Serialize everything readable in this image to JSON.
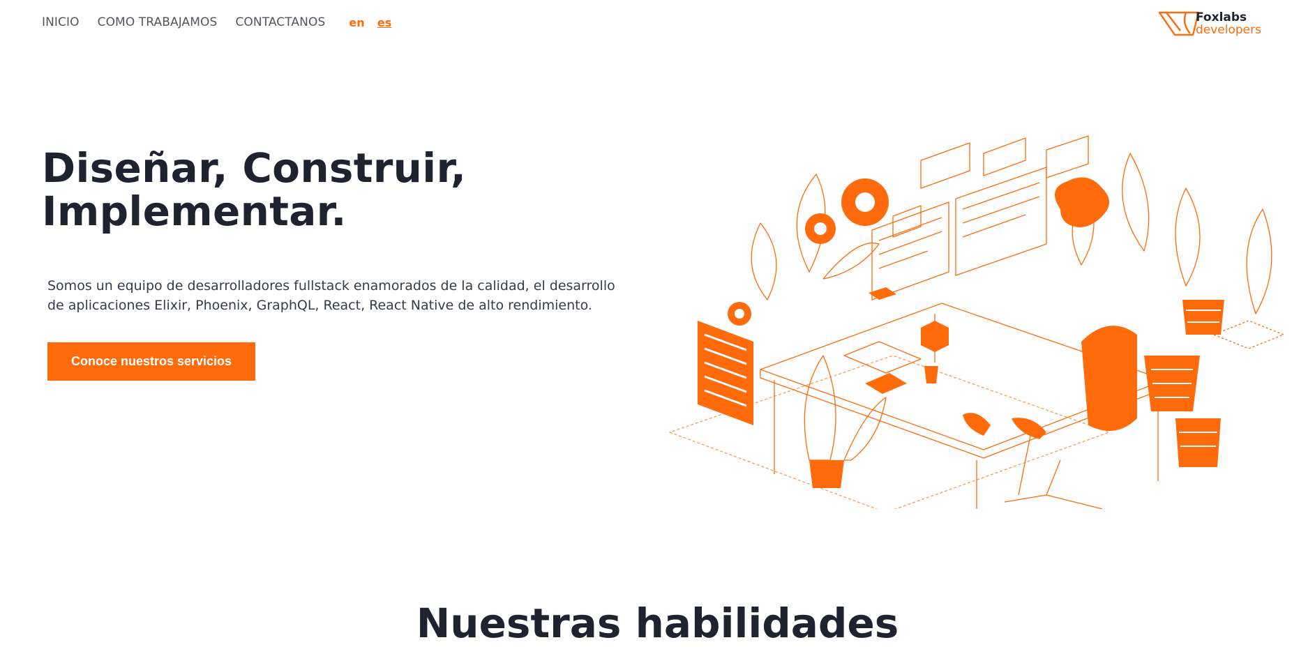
{
  "nav": {
    "items": [
      {
        "label": "INICIO"
      },
      {
        "label": "COMO TRABAJAMOS"
      },
      {
        "label": "CONTACTANOS"
      }
    ],
    "languages": [
      {
        "label": "en",
        "active": false
      },
      {
        "label": "es",
        "active": true
      }
    ]
  },
  "logo": {
    "line1": "Foxlabs",
    "line2": "developers",
    "icon": "foxlabs-logo-icon"
  },
  "hero": {
    "title_line1": "Diseñar, Construir,",
    "title_line2": "Implementar.",
    "description": "Somos un equipo de desarrolladores fullstack enamorados de la calidad, el desarrollo de aplicaciones Elixir, Phoenix, GraphQL, React, React Native de alto rendimiento.",
    "cta_label": "Conoce nuestros servicios"
  },
  "illustration": {
    "icon": "developer-workspace-illustration"
  },
  "skills": {
    "title": "Nuestras habilidades"
  },
  "colors": {
    "accent": "#ff6b0a",
    "text_dark": "#1f2330",
    "text_nav": "#4f5566"
  }
}
